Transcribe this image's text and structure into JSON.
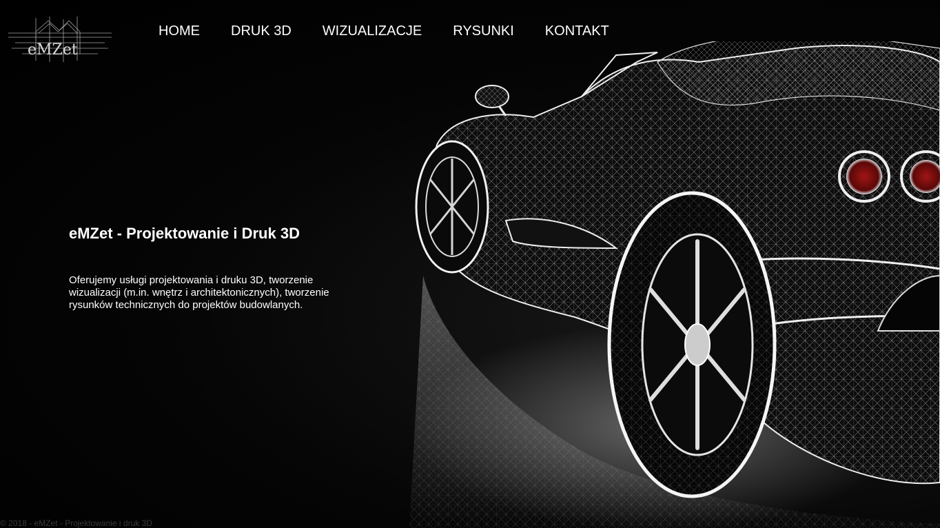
{
  "brand": {
    "logo_text": "eMZet",
    "logo_icon": "wireframe-house-icon"
  },
  "nav": {
    "items": [
      {
        "label": "HOME"
      },
      {
        "label": "DRUK 3D"
      },
      {
        "label": "WIZUALIZACJE"
      },
      {
        "label": "RYSUNKI"
      },
      {
        "label": "KONTAKT"
      }
    ]
  },
  "hero": {
    "image": "wireframe-sports-car-image",
    "title": "eMZet - Projektowanie i Druk 3D",
    "description": "Oferujemy usługi projektowania i druku 3D, tworzenie wizualizacji (m.in. wnętrz i architektonicznych), tworzenie rysunków technicznych do projektów budowlanych."
  },
  "footer": {
    "copyright": "© 2018 - eMZet - Projektowanie i druk 3D"
  },
  "colors": {
    "background": "#000000",
    "text": "#ffffff",
    "wireframe": "#d9d9d9",
    "taillight": "#8b1010",
    "footer_text": "#3a3a3a"
  }
}
